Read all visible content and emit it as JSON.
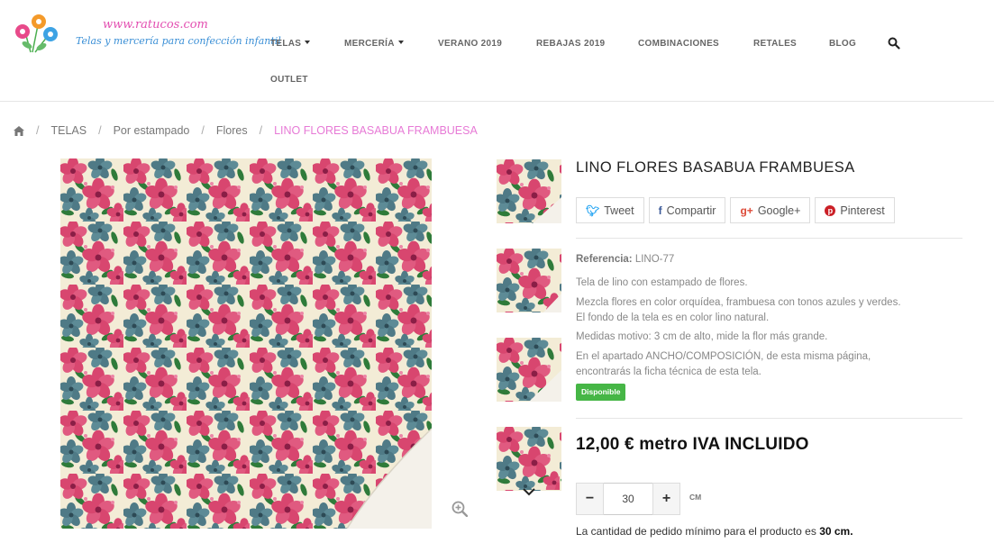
{
  "logo": {
    "url_text": "www.ratucos.com",
    "tagline": "Telas y mercería para confección infantil"
  },
  "nav": {
    "items": [
      {
        "label": "TELAS",
        "dropdown": true
      },
      {
        "label": "MERCERÍA",
        "dropdown": true
      },
      {
        "label": "VERANO 2019",
        "dropdown": false
      },
      {
        "label": "REBAJAS 2019",
        "dropdown": false
      },
      {
        "label": "COMBINACIONES",
        "dropdown": false
      },
      {
        "label": "RETALES",
        "dropdown": false
      },
      {
        "label": "BLOG",
        "dropdown": false
      },
      {
        "label": "OUTLET",
        "dropdown": false
      }
    ],
    "search_icon": "search-icon"
  },
  "breadcrumb": {
    "home_icon": "home-icon",
    "items": [
      "TELAS",
      "Por estampado",
      "Flores"
    ],
    "current": "LINO FLORES BASABUA FRAMBUESA"
  },
  "product": {
    "title": "LINO FLORES BASABUA FRAMBUESA",
    "share": {
      "tweet": "Tweet",
      "share": "Compartir",
      "google": "Google+",
      "pinterest": "Pinterest"
    },
    "reference_label": "Referencia:",
    "reference_value": "LINO-77",
    "description": [
      "Tela de lino con estampado de flores.",
      "Mezcla flores en color orquídea, frambuesa con tonos azules y verdes.",
      "El fondo de la tela es en color lino natural.",
      "Medidas motivo: 3 cm de alto, mide la flor más grande.",
      "En el apartado ANCHO/COMPOSICIÓN, de esta misma página,",
      "encontrarás la ficha técnica de esta tela."
    ],
    "availability": "Disponible",
    "price": "12,00 € metro IVA INCLUIDO",
    "quantity": {
      "minus": "−",
      "value": "30",
      "plus": "+",
      "unit": "CM"
    },
    "min_note_prefix": "La cantidad de pedido mínimo para el producto es",
    "min_note_value": "30 cm."
  },
  "colors": {
    "fabric_bg": "#f3ecd6",
    "flower_pink": "#d8466f",
    "flower_pink_light": "#ec86a6",
    "flower_teal": "#4f7a86",
    "leaf_green": "#2f7b3a",
    "breadcrumb_current": "#e77ad6",
    "available_badge": "#46b646"
  }
}
